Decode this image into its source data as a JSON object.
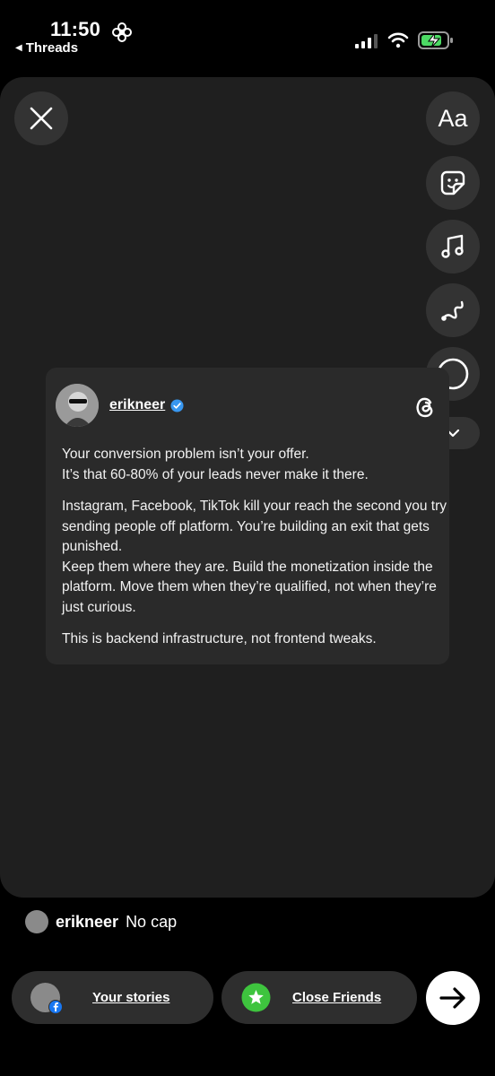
{
  "status_bar": {
    "time": "11:50",
    "back_app": "Threads"
  },
  "tools": {
    "text_tool_label": "Aa"
  },
  "post": {
    "username": "erikneer",
    "paragraphs": [
      "Your conversion problem isn’t your offer.\nIt’s that 60-80% of your leads never make it there.",
      "Instagram, Facebook, TikTok kill your reach the second you try sending people off platform. You’re building an exit that gets punished.\nKeep them where they are. Build the monetization inside the platform. Move them when they’re qualified, not when they’re just curious.",
      "This is backend infrastructure, not frontend tweaks."
    ]
  },
  "caption": {
    "username": "erikneer",
    "text": "No cap"
  },
  "bottom_bar": {
    "your_stories_label": "Your stories",
    "close_friends_label": "Close Friends"
  },
  "colors": {
    "canvas": "#1f1f1f",
    "card": "#2a2a2a",
    "button": "#333333",
    "verified": "#3897f0",
    "close_friends": "#3ec43e",
    "battery": "#4cd964"
  }
}
